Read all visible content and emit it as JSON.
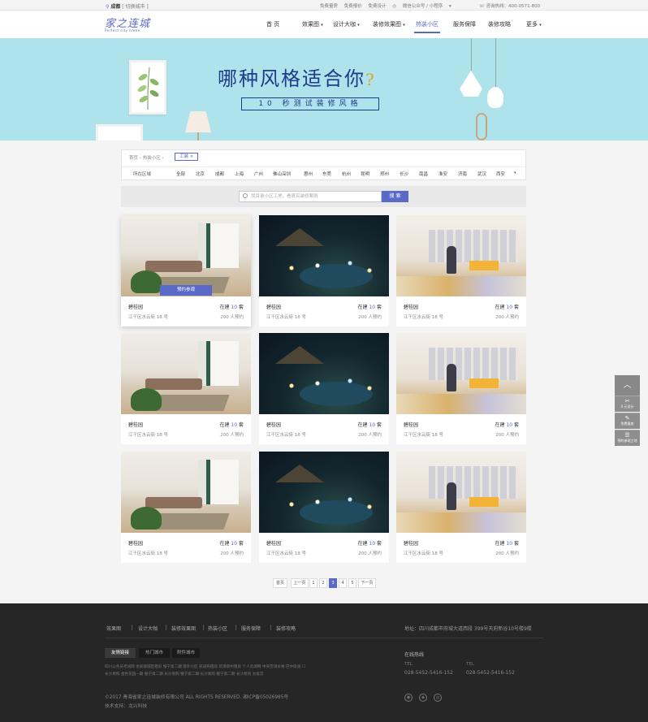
{
  "topbar": {
    "city": "成都",
    "switch_city": "[ 切换城市 ]",
    "links": [
      "免费量房",
      "免费报价",
      "免费设计"
    ],
    "wechat": "微信公众号 / 小程序",
    "hotline": "咨询热线：400-0571-800"
  },
  "logo": {
    "main": "家之连城",
    "sub": "Perfect city home"
  },
  "nav": [
    "首 页",
    "效果图",
    "设计大咖",
    "装修效果图",
    "热装小区",
    "服务保障",
    "装修攻略",
    "更多"
  ],
  "nav_active": 4,
  "banner": {
    "title_a": "哪种风格适合你",
    "title_q": "?",
    "subtitle": "10 秒测试装修风格"
  },
  "breadcrumb": {
    "home": "首页",
    "section": "热装小区",
    "tag": "工装 ×"
  },
  "filter": {
    "label": "所在区域",
    "regions": [
      "全部",
      "北京",
      "成都",
      "上海",
      "广州",
      "佛山深圳",
      "惠州",
      "东莞",
      "杭州",
      "昆明",
      "郑州",
      "长沙",
      "南昌",
      "淮安",
      "济南",
      "武汉",
      "西安"
    ],
    "more_icon": "▾"
  },
  "search": {
    "placeholder": "找目录小区工地，看真实装修案例",
    "button": "搜 索"
  },
  "cards": [
    {
      "name": "碧桂园",
      "status_pre": "在建",
      "status_num": "10",
      "status_unit": "套",
      "address": "江干区水云街 18 号",
      "count": "200 人预约",
      "reserve": "预约参观"
    },
    {
      "name": "碧桂园",
      "status_pre": "在建",
      "status_num": "10",
      "status_unit": "套",
      "address": "江干区水云街 18 号",
      "count": "200 人预约"
    },
    {
      "name": "碧桂园",
      "status_pre": "在建",
      "status_num": "10",
      "status_unit": "套",
      "address": "江干区水云街 18 号",
      "count": "200 人预约"
    },
    {
      "name": "碧桂园",
      "status_pre": "在建",
      "status_num": "10",
      "status_unit": "套",
      "address": "江干区水云街 18 号",
      "count": "200 人预约"
    },
    {
      "name": "碧桂园",
      "status_pre": "在建",
      "status_num": "10",
      "status_unit": "套",
      "address": "江干区水云街 18 号",
      "count": "200 人预约"
    },
    {
      "name": "碧桂园",
      "status_pre": "在建",
      "status_num": "10",
      "status_unit": "套",
      "address": "江干区水云街 18 号",
      "count": "200 人预约"
    },
    {
      "name": "碧桂园",
      "status_pre": "在建",
      "status_num": "10",
      "status_unit": "套",
      "address": "江干区水云街 18 号",
      "count": "200 人预约"
    },
    {
      "name": "碧桂园",
      "status_pre": "在建",
      "status_num": "10",
      "status_unit": "套",
      "address": "江干区水云街 18 号",
      "count": "200 人预约"
    },
    {
      "name": "碧桂园",
      "status_pre": "在建",
      "status_num": "10",
      "status_unit": "套",
      "address": "江干区水云街 18 号",
      "count": "200 人预约"
    }
  ],
  "pagination": [
    "首页",
    "上一页",
    "1",
    "2",
    "3",
    "4",
    "5",
    "下一页"
  ],
  "pagination_active": "3",
  "side": {
    "top_icon": "︿",
    "btn1": "0 元设计",
    "btn2": "免费量房",
    "btn3": "预约参观工地"
  },
  "footer": {
    "nav": [
      "效果图",
      "设计大咖",
      "装修效果图",
      "热装小区",
      "服务保障",
      "装修攻略"
    ],
    "address": "地址：四川成都市府城大道西段 399号天府新谷10号楼9楼",
    "tabs": [
      "友情链接",
      "热门城市",
      "附件城市"
    ],
    "links_row1": "四川公务员考试网  龙泉驿城区租房  璧宁第二期  蓉外小区  航班购租房  装潢新村租房  个人房源网  中央空调价格  巴中街道",
    "links_row2": "长沙易购  金色花园一期  璧宁第二期  长沙易购  璧宁第二期  长沙易购  璧宁第二期  长沙易购  太极宫",
    "hotline_title": "在线热线",
    "tel_label": "TEL",
    "tel1": "028-5452-5416-152",
    "tel2": "028-5452-5416-152",
    "copyright": "©2017 青海省家之连城装修有限公司 ALL RIGHTS RESERVED.   湘ICP备05026985号",
    "support": "技术支持：龙兴科技"
  },
  "colors": {
    "accent": "#5b6ac9",
    "banner": "#aee3ec",
    "footer": "#262626"
  }
}
